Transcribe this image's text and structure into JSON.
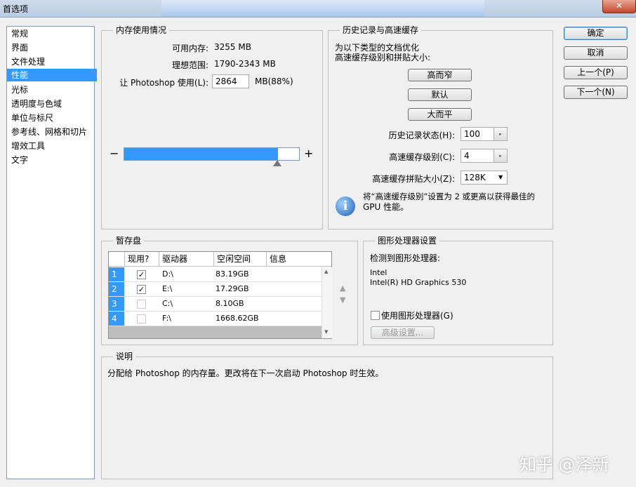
{
  "window": {
    "title": "首选项",
    "close_glyph": "✕"
  },
  "sidebar": {
    "items": [
      {
        "label": "常规"
      },
      {
        "label": "界面"
      },
      {
        "label": "文件处理"
      },
      {
        "label": "性能"
      },
      {
        "label": "光标"
      },
      {
        "label": "透明度与色域"
      },
      {
        "label": "单位与标尺"
      },
      {
        "label": "参考线、网格和切片"
      },
      {
        "label": "增效工具"
      },
      {
        "label": "文字"
      }
    ],
    "active_index": 3
  },
  "buttons": {
    "ok": "确定",
    "cancel": "取消",
    "prev": "上一个(P)",
    "next": "下一个(N)"
  },
  "memory": {
    "group_label": "内存使用情况",
    "available_label": "可用内存:",
    "available_value": "3255 MB",
    "ideal_label": "理想范围:",
    "ideal_value": "1790-2343 MB",
    "use_label": "让 Photoshop 使用(L):",
    "use_value": "2864",
    "use_unit": "MB(88%)",
    "slider_fraction": 0.88,
    "minus": "−",
    "plus": "+"
  },
  "history": {
    "group_label": "历史记录与高速缓存",
    "intro_line1": "为以下类型的文档优化",
    "intro_line2": "高速缓存级别和拼贴大小:",
    "btn_tall_thin": "高而窄",
    "btn_default": "默认",
    "btn_big_flat": "大而平",
    "states_label": "历史记录状态(H):",
    "states_value": "100",
    "levels_label": "高速缓存级别(C):",
    "levels_value": "4",
    "tile_label": "高速缓存拼贴大小(Z):",
    "tile_value": "128K",
    "info_line1": "将“高速缓存级别”设置为 2 或更高以获得最佳的",
    "info_line2": "GPU 性能。",
    "spin_glyph": "▸",
    "dropdown_glyph": "▼"
  },
  "scratch": {
    "group_label": "暂存盘",
    "headers": [
      "现用?",
      "驱动器",
      "空闲空间",
      "信息"
    ],
    "rows": [
      {
        "num": "1",
        "checked": true,
        "drive": "D:\\",
        "free": "83.19GB"
      },
      {
        "num": "2",
        "checked": true,
        "drive": "E:\\",
        "free": "17.29GB"
      },
      {
        "num": "3",
        "checked": false,
        "drive": "C:\\",
        "free": "8.10GB"
      },
      {
        "num": "4",
        "checked": false,
        "drive": "F:\\",
        "free": "1668.62GB"
      }
    ],
    "up_glyph": "▲",
    "down_glyph": "▼",
    "scroll_up": "▲",
    "scroll_down": "▼"
  },
  "gpu": {
    "group_label": "图形处理器设置",
    "detected_label": "检测到图形处理器:",
    "vendor": "Intel",
    "model": "Intel(R) HD Graphics 530",
    "use_gpu_label": "使用图形处理器(G)",
    "advanced_label": "高级设置..."
  },
  "description": {
    "group_label": "说明",
    "text": "分配给 Photoshop 的内存量。更改将在下一次启动 Photoshop 时生效。"
  },
  "watermark": "知乎 @泽新",
  "check_glyph": "✓"
}
